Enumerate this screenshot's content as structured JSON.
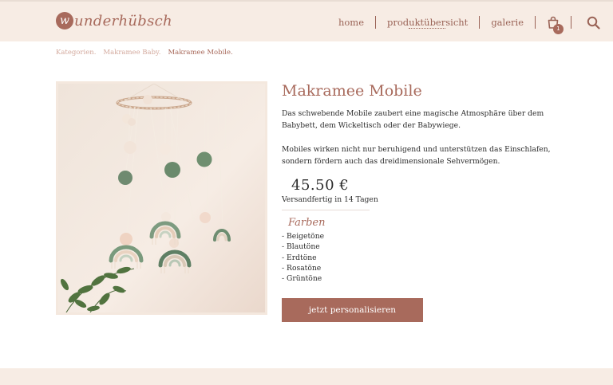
{
  "header": {
    "logo": {
      "badge_letter": "w",
      "text": "underhübsch"
    },
    "nav": {
      "home": "home",
      "products_prefix": "prod",
      "products_highlight": "uktüber",
      "products_suffix": "sicht",
      "gallery": "galerie"
    },
    "cart": {
      "icon": "shopping-bag-icon",
      "count": "1"
    },
    "search": {
      "icon": "search-icon"
    }
  },
  "breadcrumb": {
    "items": [
      "Kategorien.",
      "Makramee Baby.",
      "Makramee Mobile."
    ]
  },
  "product": {
    "image_alt": "Makramee Mobile",
    "title": "Makramee Mobile",
    "description_1": "Das schwebende Mobile zaubert eine magische Atmosphäre über dem Babybett, dem Wickeltisch oder der Babywiege.",
    "description_2": "Mobiles wirken nicht nur beruhigend und unterstützen das Einschlafen, sondern fördern auch das dreidimensionale Sehvermögen.",
    "price": "45.50 €",
    "shipping": "Versandfertig in 14 Tagen",
    "colors_heading": "Farben",
    "colors": [
      "- Beigetöne",
      "- Blautöne",
      "- Erdtöne",
      "- Rosatöne",
      "- Grüntöne"
    ],
    "cta_label": "jetzt personalisieren"
  },
  "theme": {
    "accent": "#a86a5c",
    "header_bg": "#f7ece4",
    "breadcrumb_muted": "#d3a99d"
  }
}
